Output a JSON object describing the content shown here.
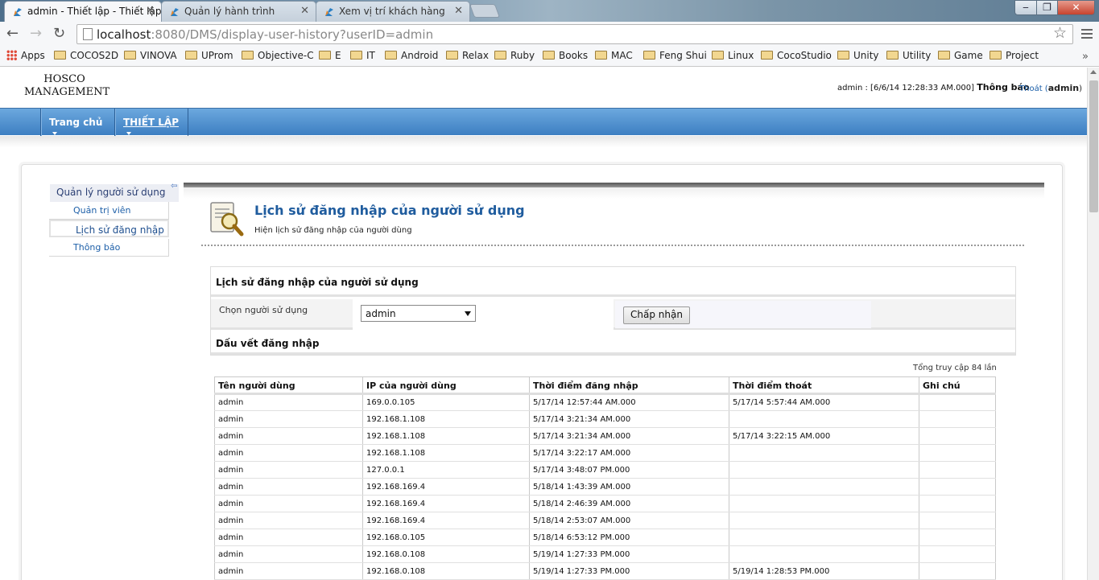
{
  "browser": {
    "tabs": [
      {
        "title": "admin - Thiết lập - Thiết lập",
        "active": true
      },
      {
        "title": "Quản lý hành trình",
        "active": false
      },
      {
        "title": "Xem vị trí khách hàng",
        "active": false
      }
    ],
    "url_host": "localhost",
    "url_path": ":8080/DMS/display-user-history?userID=admin",
    "bookmarks": [
      "Apps",
      "COCOS2D",
      "VINOVA",
      "UProm",
      "Objective-C",
      "E",
      "IT",
      "Android",
      "Relax",
      "Ruby",
      "Books",
      "MAC",
      "Feng Shui",
      "Linux",
      "CocoStudio",
      "Unity",
      "Utility",
      "Game",
      "Project"
    ]
  },
  "header": {
    "logo_line1": "HOSCO",
    "logo_line2": "MANAGEMENT",
    "user_info": "admin : [6/6/14 12:28:33 AM.000]",
    "notify_label": "Thông báo",
    "logout_label": "Thoát (",
    "logout_user": "admin",
    "logout_close": ")"
  },
  "menu": {
    "home": "Trang chủ",
    "settings": "THIẾT LẬP"
  },
  "sidebar": {
    "title": "Quản lý người sử dụng",
    "items": [
      {
        "label": "Quản trị viên"
      },
      {
        "label": "Lịch sử đăng nhập"
      },
      {
        "label": "Thông báo"
      }
    ]
  },
  "main": {
    "title": "Lịch sử đăng nhập của người sử dụng",
    "subtitle": "Hiện lịch sử đăng nhập của người dùng",
    "form_title": "Lịch sử đăng nhập của người sử dụng",
    "select_label": "Chọn người sử dụng",
    "select_value": "admin",
    "accept_button": "Chấp nhận",
    "trace_title": "Dấu vết đăng nhập",
    "total": "Tổng truy cập 84 lần"
  },
  "table": {
    "headers": [
      "Tên người dùng",
      "IP của người dùng",
      "Thời điểm đăng nhập",
      "Thời điểm thoát",
      "Ghi chú"
    ],
    "rows": [
      [
        "admin",
        "169.0.0.105",
        "5/17/14 12:57:44 AM.000",
        "5/17/14 5:57:44 AM.000",
        ""
      ],
      [
        "admin",
        "192.168.1.108",
        "5/17/14 3:21:34 AM.000",
        "",
        ""
      ],
      [
        "admin",
        "192.168.1.108",
        "5/17/14 3:21:34 AM.000",
        "5/17/14 3:22:15 AM.000",
        ""
      ],
      [
        "admin",
        "192.168.1.108",
        "5/17/14 3:22:17 AM.000",
        "",
        ""
      ],
      [
        "admin",
        "127.0.0.1",
        "5/17/14 3:48:07 PM.000",
        "",
        ""
      ],
      [
        "admin",
        "192.168.169.4",
        "5/18/14 1:43:39 AM.000",
        "",
        ""
      ],
      [
        "admin",
        "192.168.169.4",
        "5/18/14 2:46:39 AM.000",
        "",
        ""
      ],
      [
        "admin",
        "192.168.169.4",
        "5/18/14 2:53:07 AM.000",
        "",
        ""
      ],
      [
        "admin",
        "192.168.0.105",
        "5/18/14 6:53:12 PM.000",
        "",
        ""
      ],
      [
        "admin",
        "192.168.0.108",
        "5/19/14 1:27:33 PM.000",
        "",
        ""
      ],
      [
        "admin",
        "192.168.0.108",
        "5/19/14 1:27:33 PM.000",
        "5/19/14 1:28:53 PM.000",
        ""
      ]
    ]
  },
  "colors": {
    "menu_blue": "#3d7fc2",
    "title_blue": "#1f5c9e",
    "link_blue": "#1d5fa8"
  }
}
